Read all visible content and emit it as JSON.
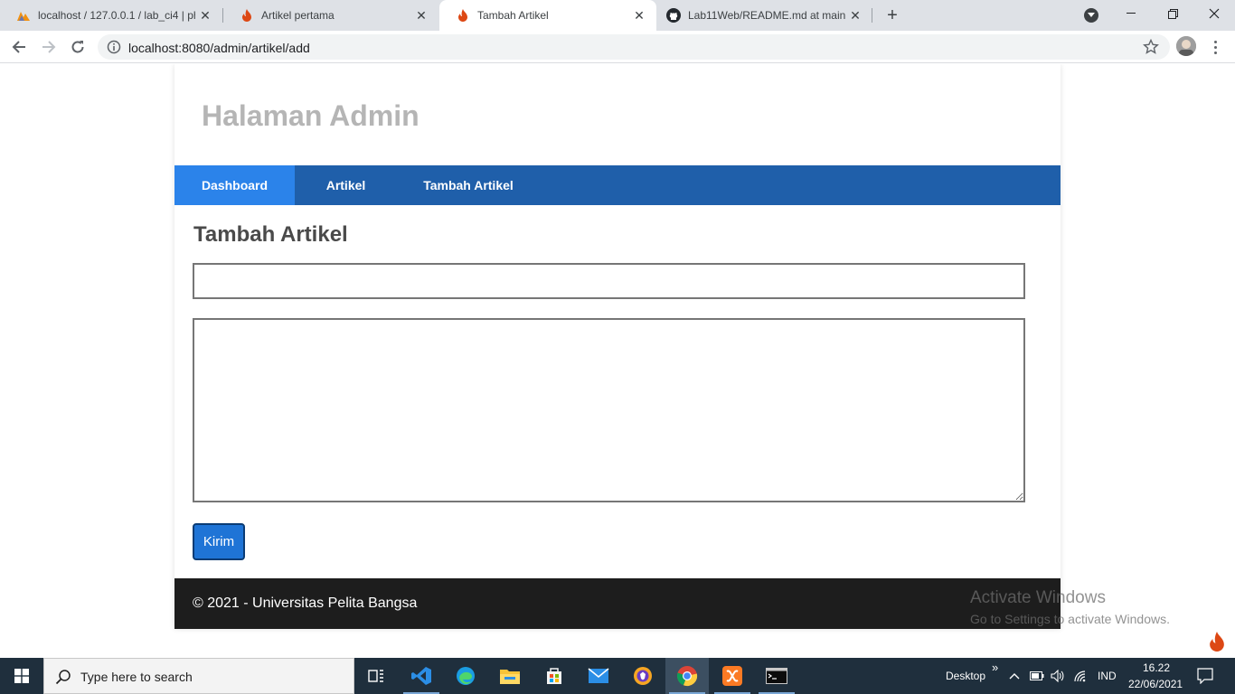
{
  "browser": {
    "tabs": [
      {
        "title": "localhost / 127.0.0.1 / lab_ci4 | php",
        "icon": "phpmyadmin-icon"
      },
      {
        "title": "Artikel pertama",
        "icon": "codeigniter-icon"
      },
      {
        "title": "Tambah Artikel",
        "icon": "codeigniter-icon",
        "active": true
      },
      {
        "title": "Lab11Web/README.md at main",
        "icon": "github-icon"
      }
    ],
    "url": "localhost:8080/admin/artikel/add"
  },
  "page": {
    "header_title": "Halaman Admin",
    "nav": [
      {
        "label": "Dashboard",
        "active": true
      },
      {
        "label": "Artikel",
        "active": false
      },
      {
        "label": "Tambah Artikel",
        "active": false
      }
    ],
    "heading": "Tambah Artikel",
    "form": {
      "title_value": "",
      "body_value": "",
      "submit_label": "Kirim"
    },
    "footer_text": "© 2021 - Universitas Pelita Bangsa"
  },
  "watermark": {
    "line1": "Activate Windows",
    "line2": "Go to Settings to activate Windows."
  },
  "taskbar": {
    "search_placeholder": "Type here to search",
    "desktop_label": "Desktop",
    "chevron": "»",
    "language": "IND",
    "time": "16.22",
    "date": "22/06/2021"
  },
  "colors": {
    "nav_bg": "#1f5faa",
    "nav_active": "#2b83ea",
    "button": "#1f74d6",
    "footer_bg": "#1d1d1d",
    "header_text": "#b5b5b5",
    "taskbar_bg": "#1f2f3d"
  }
}
